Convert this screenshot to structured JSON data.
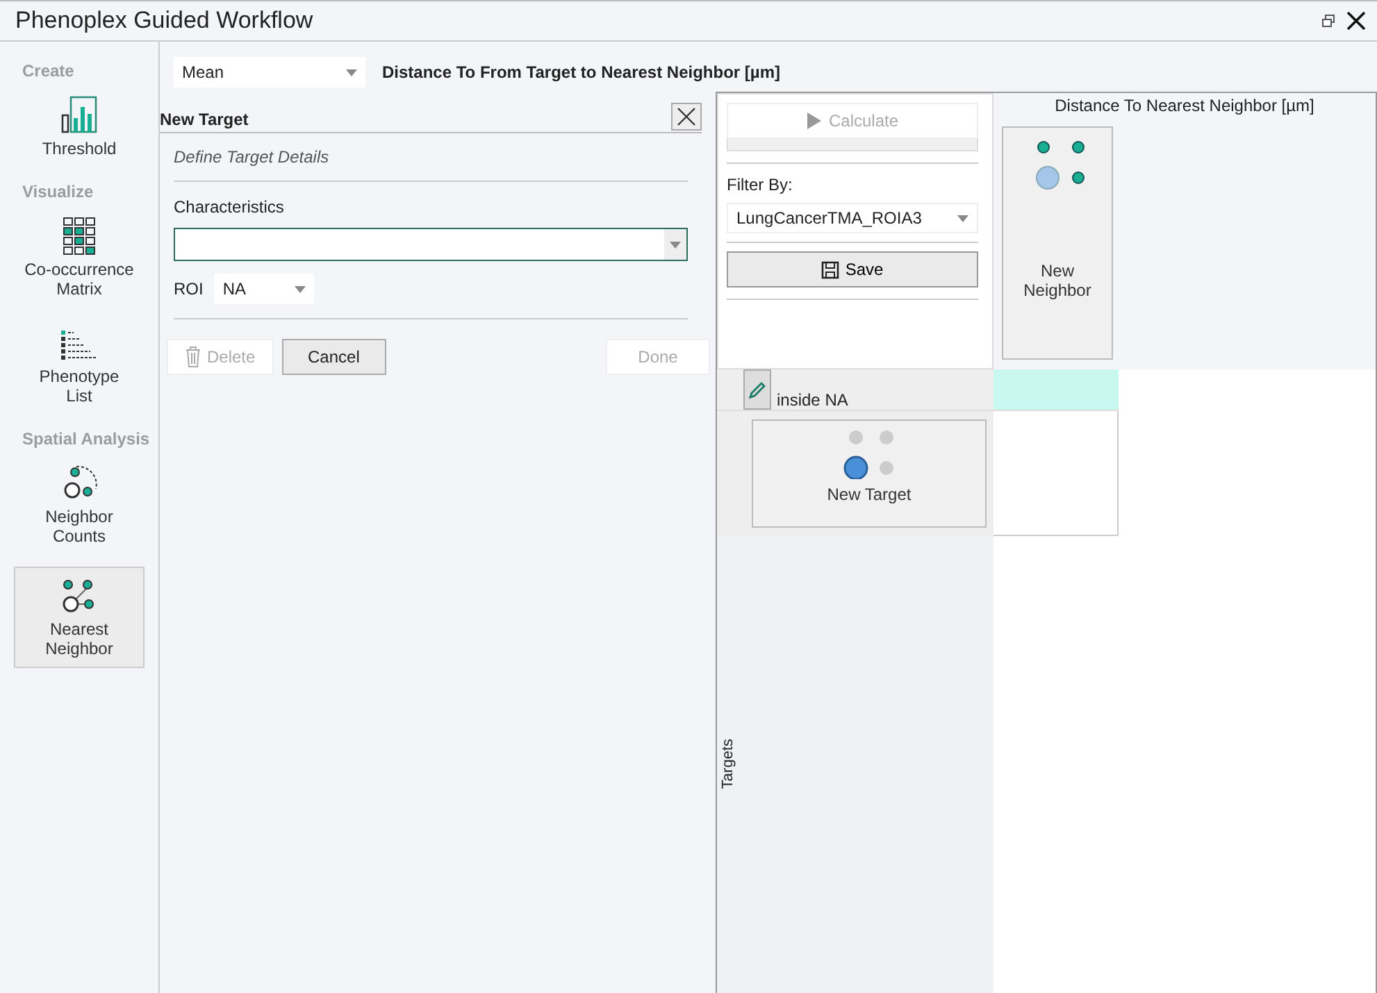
{
  "window": {
    "title": "Phenoplex Guided Workflow"
  },
  "sidebar": {
    "sections": [
      {
        "title": "Create",
        "items": [
          {
            "label_lines": [
              "Threshold"
            ],
            "selected": false
          }
        ]
      },
      {
        "title": "Visualize",
        "items": [
          {
            "label_lines": [
              "Co-occurrence",
              "Matrix"
            ],
            "selected": false
          },
          {
            "label_lines": [
              "Phenotype",
              "List"
            ],
            "selected": false
          }
        ]
      },
      {
        "title": "Spatial Analysis",
        "items": [
          {
            "label_lines": [
              "Neighbor",
              "Counts"
            ],
            "selected": false
          },
          {
            "label_lines": [
              "Nearest",
              "Neighbor"
            ],
            "selected": true
          }
        ]
      }
    ]
  },
  "statistic": {
    "value": "Mean"
  },
  "heading": "Distance To From Target to Nearest Neighbor [µm]",
  "panel": {
    "title": "New Target",
    "subtitle": "Define Target Details",
    "characteristics_label": "Characteristics",
    "roi_label": "ROI",
    "roi_value": "NA",
    "buttons": [
      {
        "label": "Delete",
        "kind": "delete",
        "disabled": true
      },
      {
        "label": "Cancel",
        "kind": "plain",
        "disabled": false
      },
      {
        "label": "Done",
        "kind": "plain",
        "disabled": true
      }
    ]
  },
  "matrix": {
    "calculate": {
      "label": "Calculate",
      "disabled": true
    },
    "progress": {
      "level": 0
    },
    "filter_label": "Filter By:",
    "filter_value": "LungCancerTMA_ROIA3",
    "save": {
      "label": "Save"
    },
    "column_header": "Distance To Nearest Neighbor [µm]",
    "columns": [
      {
        "label": "New Neighbor"
      }
    ],
    "groups": [
      {
        "label": "inside NA",
        "highlighted": true,
        "rows": [
          {
            "label": "New Target"
          }
        ]
      }
    ],
    "axis_label": "Targets"
  }
}
